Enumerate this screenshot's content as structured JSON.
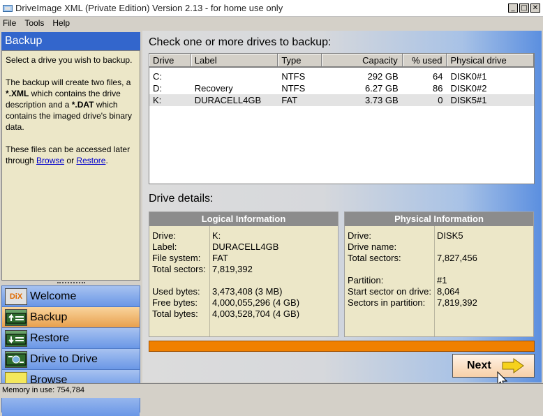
{
  "window": {
    "title": "DriveImage XML (Private Edition) Version 2.13 - for home use only",
    "buttons": {
      "minimize": "_",
      "maximize": "□",
      "close": "✕"
    }
  },
  "menu": [
    {
      "label": "File"
    },
    {
      "label": "Tools"
    },
    {
      "label": "Help"
    }
  ],
  "sidebar": {
    "header": "Backup",
    "help_p1": "Select a drive you wish to backup.",
    "help_p2_prefix": "The backup will create two files, a ",
    "help_p2_xml": "*.XML",
    "help_p2_mid": " which contains the drive description and a ",
    "help_p2_dat": "*.DAT",
    "help_p2_suffix": " which contains the imaged drive's binary data.",
    "help_p3_prefix": "These files can be accessed later through ",
    "help_p3_browse": "Browse",
    "help_p3_or": " or ",
    "help_p3_restore": "Restore",
    "help_p3_suffix": ".",
    "nav": [
      {
        "label": "Welcome",
        "icon": "dix-logo-icon",
        "icon_text": "DiX",
        "active": false
      },
      {
        "label": "Backup",
        "icon": "backup-drive-icon",
        "active": true
      },
      {
        "label": "Restore",
        "icon": "restore-drive-icon",
        "active": false
      },
      {
        "label": "Drive to Drive",
        "icon": "drive-to-drive-icon",
        "active": false
      },
      {
        "label": "Browse",
        "icon": "folder-icon",
        "active": false
      }
    ]
  },
  "main": {
    "drives_heading": "Check one or more drives to backup:",
    "table": {
      "columns": [
        "Drive",
        "Label",
        "Type",
        "Capacity",
        "% used",
        "Physical drive"
      ],
      "rows": [
        [
          "C:",
          "",
          "NTFS",
          "292 GB",
          "64",
          "DISK0#1"
        ],
        [
          "D:",
          "Recovery",
          "NTFS",
          "6.27 GB",
          "86",
          "DISK0#2"
        ],
        [
          "K:",
          "DURACELL4GB",
          "FAT",
          "3.73 GB",
          "0",
          "DISK5#1"
        ]
      ],
      "selected_row": 2
    },
    "details_heading": "Drive details:",
    "logical": {
      "title": "Logical Information",
      "labels": [
        "Drive:",
        "Label:",
        "File system:",
        "Total sectors:",
        "Used bytes:",
        "Free bytes:",
        "Total bytes:"
      ],
      "values": [
        "K:",
        "DURACELL4GB",
        "FAT",
        "7,819,392",
        "3,473,408 (3 MB)",
        "4,000,055,296 (4 GB)",
        "4,003,528,704 (4 GB)"
      ]
    },
    "physical": {
      "title": "Physical Information",
      "labels": [
        "Drive:",
        "Drive name:",
        "Total sectors:",
        "Partition:",
        "Start sector on drive:",
        "Sectors in partition:"
      ],
      "values": [
        "DISK5",
        "",
        "7,827,456",
        "#1",
        "8,064",
        "7,819,392"
      ]
    },
    "progress_percent": 100,
    "next_label": "Next",
    "colors": {
      "accent": "#3366cc",
      "progress": "#f08000",
      "panel": "#ece7c8"
    }
  },
  "status": {
    "text": "Memory in use: 754,784"
  }
}
